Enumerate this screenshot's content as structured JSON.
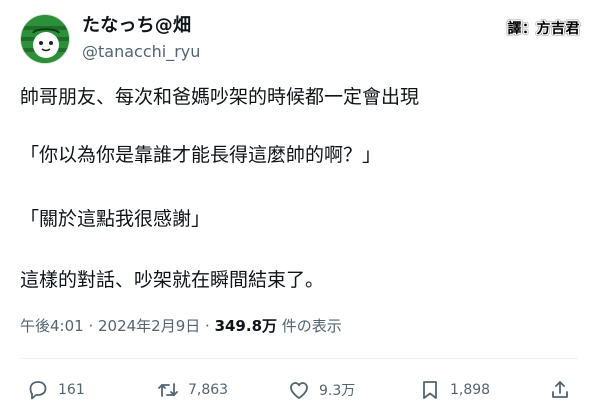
{
  "user": {
    "display_name": "たなっち@畑",
    "handle": "@tanacchi_ryu",
    "avatar": "watermelon-character-avatar"
  },
  "translator_badge": "譯：方吉君",
  "tweet": {
    "lines": [
      "帥哥朋友、每次和爸媽吵架的時候都一定會出現",
      "「你以為你是靠誰才能長得這麼帥的啊？」",
      "「關於這點我很感謝」",
      "這樣的對話、吵架就在瞬間結束了。"
    ]
  },
  "meta": {
    "timestamp": "午後4:01 · 2024年2月9日 · ",
    "views_count": "349.8万",
    "views_label": " 件の表示"
  },
  "actions": {
    "reply_count": "161",
    "repost_count": "7,863",
    "like_count": "9.3万",
    "bookmark_count": "1,898"
  },
  "icons": {
    "reply": "speech-bubble-icon",
    "repost": "repost-arrows-icon",
    "like": "heart-icon",
    "bookmark": "bookmark-icon",
    "share": "share-upload-icon"
  },
  "colors": {
    "text_primary": "#0f1419",
    "text_secondary": "#536471",
    "divider": "#eff3f4",
    "avatar_green": "#2c8f3a"
  }
}
